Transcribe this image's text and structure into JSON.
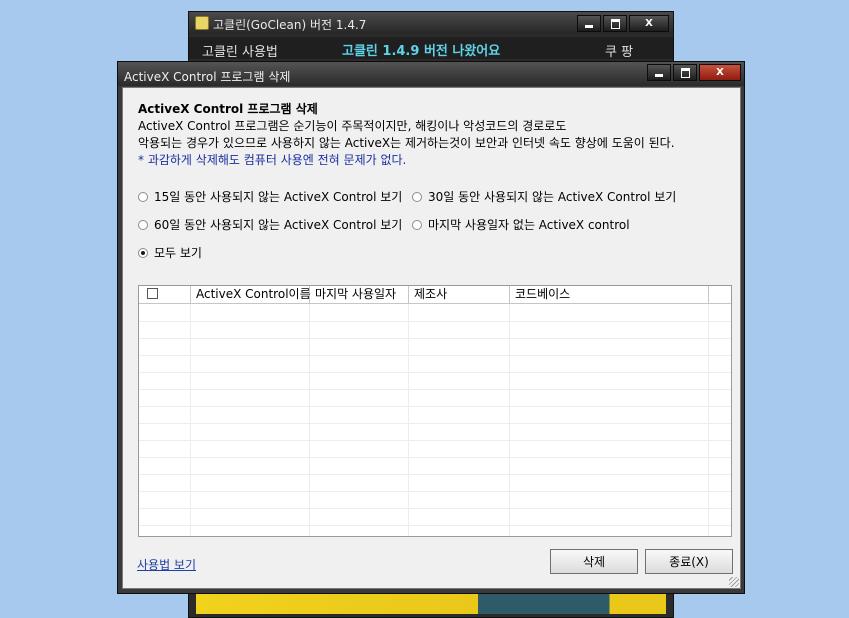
{
  "background_window": {
    "title": "고클린(GoClean) 버전 1.4.7",
    "menu_usage": "고클린 사용법",
    "banner": "고클린 1.4.9 버전 나왔어요",
    "coupon": "쿠 팡",
    "controls": {
      "close": "X"
    }
  },
  "dialog": {
    "title": "ActiveX Control 프로그램 삭제",
    "controls": {
      "close": "X"
    },
    "heading": "ActiveX Control 프로그램 삭제",
    "desc_line1": "ActiveX Control 프로그램은 순기능이 주목적이지만, 해킹이나 악성코드의 경로로도",
    "desc_line2": "악용되는 경우가 있으므로 사용하지 않는 ActiveX는 제거하는것이 보안과 인터넷 속도 향상에 도움이 된다.",
    "note": "* 과감하게 삭제해도 컴퓨터 사용엔 전혀 문제가 없다.",
    "filters": [
      {
        "label": "15일 동안 사용되지 않는 ActiveX Control 보기",
        "selected": false
      },
      {
        "label": "30일 동안 사용되지 않는 ActiveX Control 보기",
        "selected": false
      },
      {
        "label": "60일 동안 사용되지 않는 ActiveX Control 보기",
        "selected": false
      },
      {
        "label": "마지막 사용일자 없는 ActiveX control",
        "selected": false
      },
      {
        "label": "모두 보기",
        "selected": true
      }
    ],
    "table": {
      "columns": [
        "ActiveX Control이름",
        "마지막 사용일자",
        "제조사",
        "코드베이스"
      ],
      "rows": []
    },
    "help_link": "사용법 보기",
    "delete_button": "삭제",
    "close_button": "종료(X)"
  }
}
